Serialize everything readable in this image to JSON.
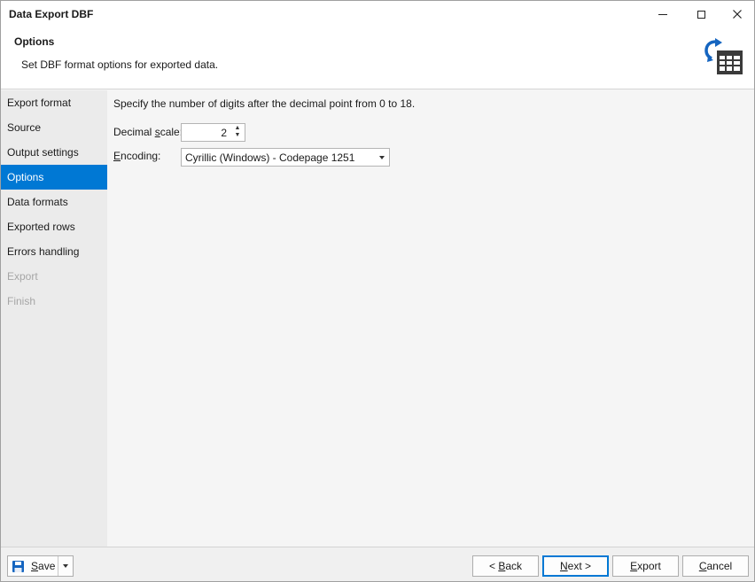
{
  "window": {
    "title": "Data Export DBF",
    "controls": {
      "minimize": "minimize-icon",
      "maximize": "maximize-icon",
      "close": "close-icon"
    }
  },
  "header": {
    "title": "Options",
    "description": "Set DBF format options for exported data.",
    "icon": "export-table-icon"
  },
  "sidebar": {
    "items": [
      {
        "label": "Export format",
        "state": "normal"
      },
      {
        "label": "Source",
        "state": "normal"
      },
      {
        "label": "Output settings",
        "state": "normal"
      },
      {
        "label": "Options",
        "state": "active"
      },
      {
        "label": "Data formats",
        "state": "normal"
      },
      {
        "label": "Exported rows",
        "state": "normal"
      },
      {
        "label": "Errors handling",
        "state": "normal"
      },
      {
        "label": "Export",
        "state": "disabled"
      },
      {
        "label": "Finish",
        "state": "disabled"
      }
    ]
  },
  "main": {
    "hint": "Specify the number of digits after the decimal point from 0 to 18.",
    "decimal_scale": {
      "label_before": "Decimal ",
      "label_mnemonic": "s",
      "label_after": "cale:",
      "value": "2"
    },
    "encoding": {
      "label_mnemonic": "E",
      "label_after": "ncoding:",
      "value": "Cyrillic (Windows) - Codepage 1251"
    }
  },
  "footer": {
    "save": {
      "label_mnemonic": "S",
      "label_after": "ave"
    },
    "back": {
      "label_before": "< ",
      "label_mnemonic": "B",
      "label_after": "ack"
    },
    "next": {
      "label_mnemonic": "N",
      "label_after": "ext >"
    },
    "export": {
      "label_mnemonic": "E",
      "label_after": "xport"
    },
    "cancel": {
      "label_mnemonic": "C",
      "label_after": "ancel"
    }
  },
  "colors": {
    "accent": "#0078d4",
    "icon_blue": "#1565c0",
    "icon_dark": "#3a3a3a"
  }
}
